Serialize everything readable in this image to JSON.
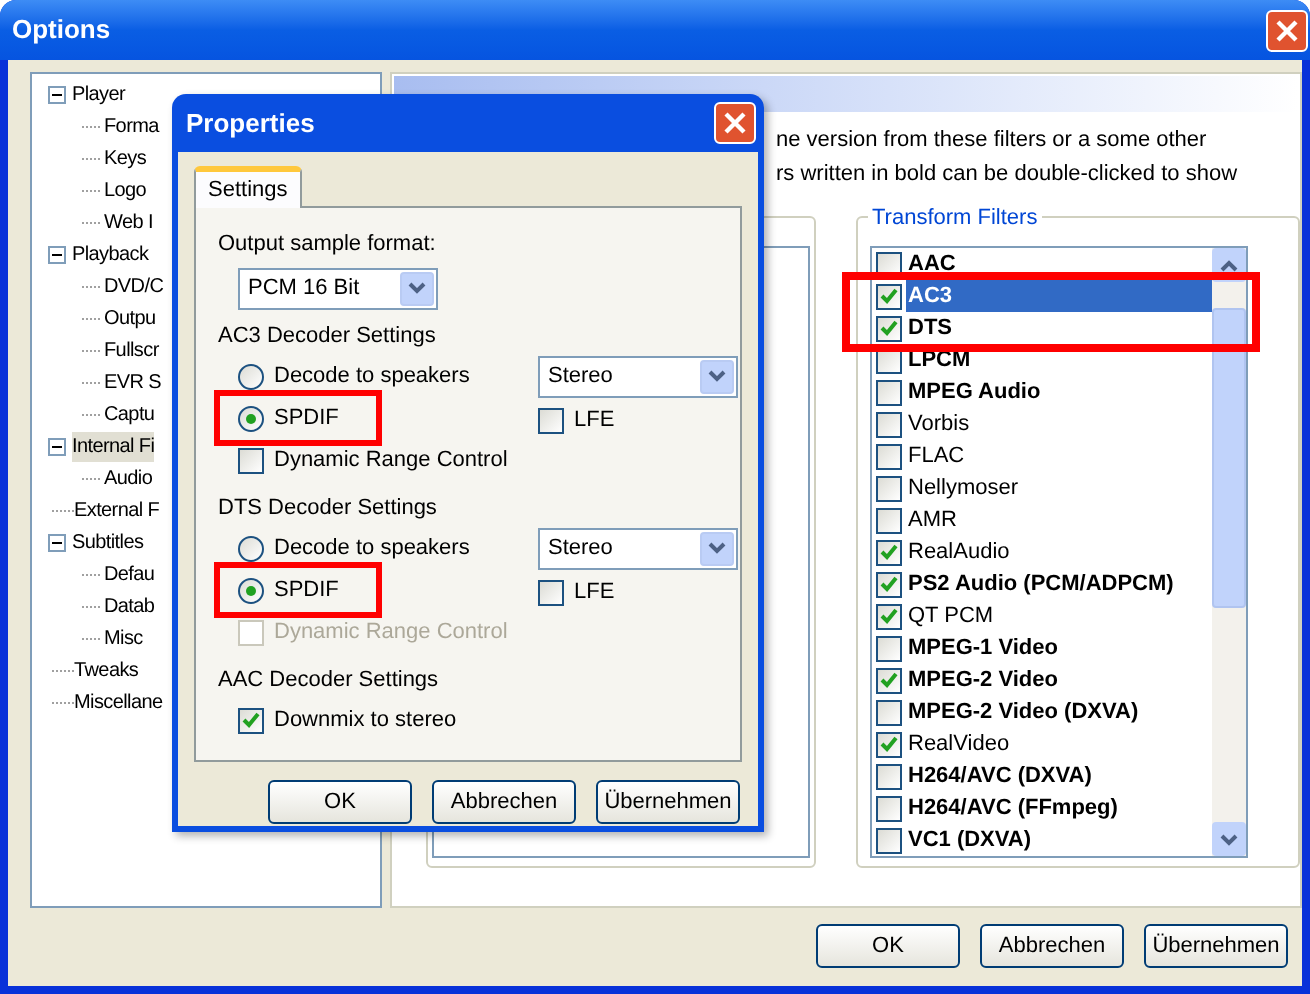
{
  "window": {
    "title": "Options"
  },
  "tree": [
    {
      "label": "Player",
      "expanded": true,
      "selected": false,
      "children": [
        {
          "label": "Forma",
          "selected": false
        },
        {
          "label": "Keys",
          "selected": false
        },
        {
          "label": "Logo",
          "selected": false
        },
        {
          "label": "Web I",
          "selected": false
        }
      ]
    },
    {
      "label": "Playback",
      "expanded": true,
      "selected": false,
      "children": [
        {
          "label": "DVD/C",
          "selected": false
        },
        {
          "label": "Outpu",
          "selected": false
        },
        {
          "label": "Fullscr",
          "selected": false
        },
        {
          "label": "EVR S",
          "selected": false
        },
        {
          "label": "Captu",
          "selected": false
        }
      ]
    },
    {
      "label": "Internal Fi",
      "expanded": true,
      "selected": true,
      "children": [
        {
          "label": "Audio",
          "selected": false
        }
      ]
    },
    {
      "label": "External F",
      "selected": false
    },
    {
      "label": "Subtitles",
      "expanded": true,
      "selected": false,
      "children": [
        {
          "label": "Defau",
          "selected": false
        },
        {
          "label": "Datab",
          "selected": false
        },
        {
          "label": "Misc",
          "selected": false
        }
      ]
    },
    {
      "label": "Tweaks",
      "selected": false
    },
    {
      "label": "Miscellane",
      "selected": false
    }
  ],
  "page": {
    "description": [
      "ne version from these filters or a some other",
      "rs written in bold can be double-clicked to show"
    ]
  },
  "transform_filters": {
    "title": "Transform Filters",
    "items": [
      {
        "name": "AAC",
        "bold": true,
        "checked": false,
        "selected": false,
        "highlighted": false
      },
      {
        "name": "AC3",
        "bold": true,
        "checked": true,
        "selected": true,
        "highlighted": true
      },
      {
        "name": "DTS",
        "bold": true,
        "checked": true,
        "selected": false,
        "highlighted": true
      },
      {
        "name": "LPCM",
        "bold": true,
        "checked": false,
        "selected": false,
        "highlighted": false
      },
      {
        "name": "MPEG Audio",
        "bold": true,
        "checked": false,
        "selected": false,
        "highlighted": false
      },
      {
        "name": "Vorbis",
        "bold": false,
        "checked": false,
        "selected": false,
        "highlighted": false
      },
      {
        "name": "FLAC",
        "bold": false,
        "checked": false,
        "selected": false,
        "highlighted": false
      },
      {
        "name": "Nellymoser",
        "bold": false,
        "checked": false,
        "selected": false,
        "highlighted": false
      },
      {
        "name": "AMR",
        "bold": false,
        "checked": false,
        "selected": false,
        "highlighted": false
      },
      {
        "name": "RealAudio",
        "bold": false,
        "checked": true,
        "selected": false,
        "highlighted": false
      },
      {
        "name": "PS2 Audio (PCM/ADPCM)",
        "bold": true,
        "checked": true,
        "selected": false,
        "highlighted": false
      },
      {
        "name": "QT PCM",
        "bold": false,
        "checked": true,
        "selected": false,
        "highlighted": false
      },
      {
        "name": "MPEG-1 Video",
        "bold": true,
        "checked": false,
        "selected": false,
        "highlighted": false
      },
      {
        "name": "MPEG-2 Video",
        "bold": true,
        "checked": true,
        "selected": false,
        "highlighted": false
      },
      {
        "name": "MPEG-2 Video (DXVA)",
        "bold": true,
        "checked": false,
        "selected": false,
        "highlighted": false
      },
      {
        "name": "RealVideo",
        "bold": false,
        "checked": true,
        "selected": false,
        "highlighted": false
      },
      {
        "name": "H264/AVC (DXVA)",
        "bold": true,
        "checked": false,
        "selected": false,
        "highlighted": false
      },
      {
        "name": "H264/AVC (FFmpeg)",
        "bold": true,
        "checked": false,
        "selected": false,
        "highlighted": false
      },
      {
        "name": "VC1 (DXVA)",
        "bold": true,
        "checked": false,
        "selected": false,
        "highlighted": false
      }
    ]
  },
  "buttons": [
    "OK",
    "Abbrechen",
    "Übernehmen"
  ],
  "properties": {
    "title": "Properties",
    "tabs": [
      {
        "label": "Settings",
        "selected": true
      }
    ],
    "output_format": {
      "label": "Output sample format:",
      "value": "PCM 16 Bit"
    },
    "sections": [
      {
        "title": "AC3 Decoder Settings",
        "rows": [
          {
            "kind": "radio",
            "label": "Decode to speakers",
            "selected": false,
            "combo": "Stereo"
          },
          {
            "kind": "radio",
            "label": "SPDIF",
            "selected": true,
            "highlighted": true,
            "extra": {
              "label": "LFE",
              "checked": false
            }
          },
          {
            "kind": "checkbox",
            "label": "Dynamic Range Control",
            "checked": false,
            "disabled": false
          }
        ]
      },
      {
        "title": "DTS Decoder Settings",
        "rows": [
          {
            "kind": "radio",
            "label": "Decode to speakers",
            "selected": false,
            "combo": "Stereo"
          },
          {
            "kind": "radio",
            "label": "SPDIF",
            "selected": true,
            "highlighted": true,
            "extra": {
              "label": "LFE",
              "checked": false
            }
          },
          {
            "kind": "checkbox",
            "label": "Dynamic Range Control",
            "checked": false,
            "disabled": true
          }
        ]
      },
      {
        "title": "AAC Decoder Settings",
        "rows": [
          {
            "kind": "checkbox",
            "label": "Downmix to stereo",
            "checked": true,
            "disabled": false
          }
        ]
      }
    ],
    "buttons": [
      "OK",
      "Abbrechen",
      "Übernehmen"
    ]
  }
}
